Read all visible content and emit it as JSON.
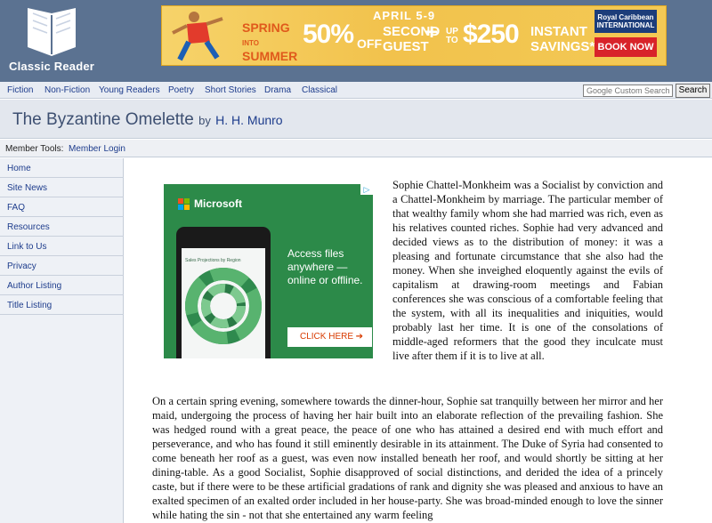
{
  "site": {
    "name": "Classic Reader"
  },
  "banner": {
    "date": "APRIL 5-9",
    "spring_line1": "SPRING",
    "spring_line1b": "INTO",
    "spring_line2": "SUMMER",
    "percent": "50%",
    "off": "OFF",
    "second_line1": "SECOND",
    "second_line2": "GUEST",
    "plus": "+",
    "upto": "UP TO",
    "amount": "$250",
    "instant_line1": "INSTANT",
    "instant_line2": "SAVINGS*",
    "brand": "Royal Caribbean INTERNATIONAL",
    "cta": "BOOK NOW",
    "accent": "#d8232a"
  },
  "nav": {
    "items": [
      "Fiction",
      "Non-Fiction",
      "Young Readers",
      "Poetry",
      "Short Stories",
      "Drama",
      "Classical"
    ],
    "search_placeholder": "Google Custom Search",
    "search_button": "Search"
  },
  "book": {
    "title": "The Byzantine Omelette",
    "by": "by",
    "author": "H. H. Munro"
  },
  "member_tools": {
    "label": "Member Tools:",
    "login": "Member Login"
  },
  "sidebar": {
    "items": [
      "Home",
      "Site News",
      "FAQ",
      "Resources",
      "Link to Us",
      "Privacy",
      "Author Listing",
      "Title Listing"
    ]
  },
  "ad": {
    "brand": "Microsoft",
    "screen_label": "Sales Projections by Region",
    "copy": "Access files anywhere — online or offline.",
    "cta": "CLICK HERE",
    "cta_arrow": "➔",
    "adchoices_icon": "adchoices-icon",
    "background": "#2c8a49"
  },
  "text": {
    "para1": "Sophie Chattel-Monkheim was a Socialist by conviction and a Chattel-Monkheim by marriage. The particular member of that wealthy family whom she had married was rich, even as his relatives counted riches. Sophie had very advanced and decided views as to the distribution of money: it was a pleasing and fortunate circumstance that she also had the money. When she inveighed eloquently against the evils of capitalism at drawing-room meetings and Fabian conferences she was conscious of a comfortable feeling that the system, with all its inequalities and iniquities, would probably last her time. It is one of the consolations of middle-aged reformers that the good they inculcate must live after them if it is to live at all.",
    "para2": "On a certain spring evening, somewhere towards the dinner-hour, Sophie sat tranquilly between her mirror and her maid, undergoing the process of having her hair built into an elaborate reflection of the prevailing fashion. She was hedged round with a great peace, the peace of one who has attained a desired end with much effort and perseverance, and who has found it still eminently desirable in its attainment. The Duke of Syria had consented to come beneath her roof as a guest, was even now installed beneath her roof, and would shortly be sitting at her dining-table. As a good Socialist, Sophie disapproved of social distinctions, and derided the idea of a princely caste, but if there were to be these artificial gradations of rank and dignity she was pleased and anxious to have an exalted specimen of an exalted order included in her house-party. She was broad-minded enough to love the sinner while hating the sin - not that she entertained any warm feeling"
  }
}
